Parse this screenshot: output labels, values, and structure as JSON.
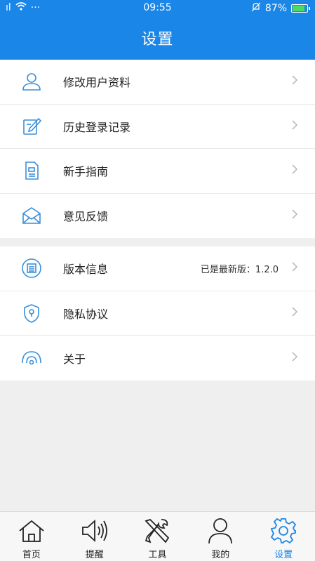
{
  "status_bar": {
    "signal": "ıl",
    "more": "···",
    "time": "09:55",
    "battery": "87%",
    "battery_level": 0.87
  },
  "header": {
    "title": "设置"
  },
  "settings_group_1": [
    {
      "label": "修改用户资料",
      "icon": "user-icon"
    },
    {
      "label": "历史登录记录",
      "icon": "edit-icon"
    },
    {
      "label": "新手指南",
      "icon": "document-icon"
    },
    {
      "label": "意见反馈",
      "icon": "envelope-icon"
    }
  ],
  "settings_group_2": [
    {
      "label": "版本信息",
      "value": "已是最新版：1.2.0",
      "icon": "version-icon"
    },
    {
      "label": "隐私协议",
      "icon": "shield-icon"
    },
    {
      "label": "关于",
      "icon": "about-icon"
    }
  ],
  "tabbar": [
    {
      "label": "首页",
      "icon": "home-icon"
    },
    {
      "label": "提醒",
      "icon": "speaker-icon"
    },
    {
      "label": "工具",
      "icon": "tools-icon"
    },
    {
      "label": "我的",
      "icon": "profile-icon"
    },
    {
      "label": "设置",
      "icon": "gear-icon",
      "active": true
    }
  ],
  "colors": {
    "accent": "#1a86e8",
    "background": "#efefef",
    "icon_blue": "#3a8fd9"
  }
}
